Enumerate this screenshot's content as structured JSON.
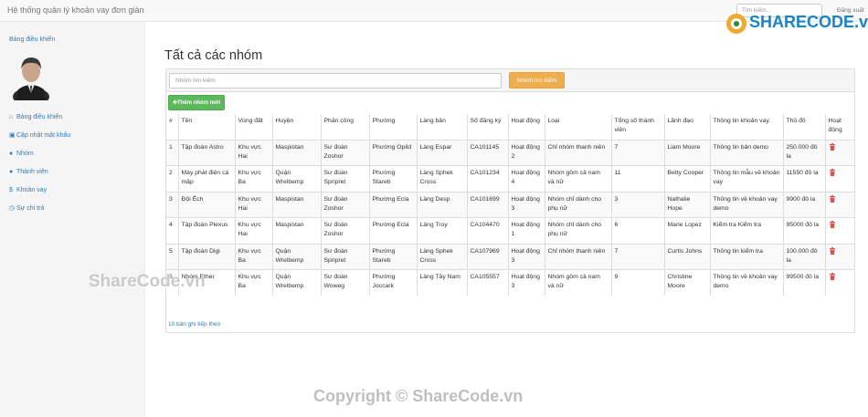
{
  "app": {
    "title": "Hệ thống quản lý khoản vay đơn giản",
    "search_placeholder": "Tìm kiếm...",
    "logout_label": "Đăng xuất"
  },
  "sidebar": {
    "dashboard_link": "Bảng điều khiển",
    "items": [
      {
        "label": "Bảng điều khiển",
        "icon": "home-icon"
      },
      {
        "label": "Cập nhật mật khẩu",
        "icon": "lock-icon"
      },
      {
        "label": "Nhóm",
        "icon": "user-icon"
      },
      {
        "label": "Thành viên",
        "icon": "user-icon"
      },
      {
        "label": "Khoản vay",
        "icon": "dollar-icon"
      },
      {
        "label": "Sự chi trả",
        "icon": "clock-icon"
      }
    ]
  },
  "main": {
    "title": "Tất cả các nhóm",
    "filter_placeholder": "Nhóm tìm kiếm",
    "search_button": "Nhóm tìm kiếm",
    "add_button": "Thêm nhóm mới",
    "more_link": "10 bản ghi tiếp theo",
    "columns": [
      "#",
      "Tên",
      "Vùng đất",
      "Huyện",
      "Phân công",
      "Phường",
      "Làng bản",
      "Số đăng ký",
      "Hoạt động",
      "Loại",
      "Tổng số thành viên",
      "Lãnh đạo",
      "Thông tin khoản vay.",
      "Thủ đô",
      "Hoạt động"
    ],
    "rows": [
      [
        "1",
        "Tập đoàn Astro",
        "Khu vực Hai",
        "Maspistan",
        "Sư đoàn Zoshor",
        "Phường Opild",
        "Làng Espar",
        "CA101145",
        "Hoạt động 2",
        "Chỉ nhóm thanh niên",
        "7",
        "Liam Moore",
        "Thông tin bản demo",
        "250.000 đô la"
      ],
      [
        "2",
        "Máy phát điện cá mập",
        "Khu vực Ba",
        "Quận Wrelbemp",
        "Sư đoàn Spripret",
        "Phường Stareb",
        "Làng Sphek Cross",
        "CA101234",
        "Hoạt động 4",
        "Nhóm gồm cả nam và nữ",
        "11",
        "Betty Cooper",
        "Thông tin mẫu về khoản vay",
        "11550 đô la"
      ],
      [
        "3",
        "Đội Ếch",
        "Khu vực Hai",
        "Maspistan",
        "Sư đoàn Zoshor",
        "Phường Ecla",
        "Làng Desp",
        "CA101699",
        "Hoạt động 3",
        "Nhóm chỉ dành cho phụ nữ",
        "3",
        "Nathalie Hope",
        "Thông tin về khoản vay demo",
        "9900 đô la"
      ],
      [
        "4",
        "Tập đoàn Plexus",
        "Khu vực Hai",
        "Maspistan",
        "Sư đoàn Zoshor",
        "Phường Ecla",
        "Làng Troy",
        "CA104470",
        "Hoạt động 1",
        "Nhóm chỉ dành cho phụ nữ",
        "6",
        "Marie Lopez",
        "Kiểm tra Kiểm tra",
        "95000 đô la"
      ],
      [
        "5",
        "Tập đoàn Digi",
        "Khu vực Ba",
        "Quận Wrelbemp",
        "Sư đoàn Spripret",
        "Phường Stareb",
        "Làng Sphek Cross",
        "CA107969",
        "Hoạt động 3",
        "Chỉ nhóm thanh niên",
        "7",
        "Curtis Johns",
        "Thông tin kiểm tra",
        "100.000 đô la"
      ],
      [
        "6",
        "Nhóm Ether",
        "Khu vực Ba",
        "Quận Wrelbemp",
        "Sư đoàn Woweg",
        "Phường Joccark",
        "Làng Tây Nam",
        "CA105557",
        "Hoạt động 3",
        "Nhóm gồm cả nam và nữ",
        "9",
        "Christine Moore",
        "Thông tin về khoản vay demo",
        "99500 đô la"
      ]
    ]
  },
  "watermarks": {
    "logo": "SHARECODE.vn",
    "middle": "ShareCode.vn",
    "bottom": "Copyright © ShareCode.vn"
  },
  "colors": {
    "link": "#337ab7",
    "warning": "#f0ad4e",
    "success": "#5cb85c",
    "danger": "#d9534f"
  }
}
